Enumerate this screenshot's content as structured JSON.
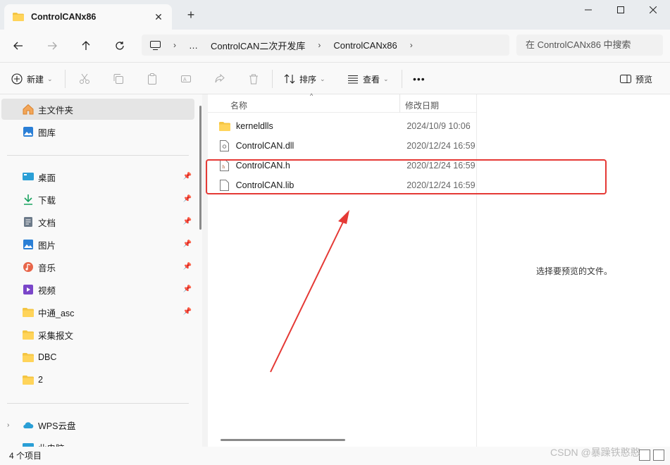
{
  "window": {
    "tab_title": "ControlCANx86",
    "tab_close": "✕",
    "new_tab": "+"
  },
  "address": {
    "segments": [
      "…",
      "ControlCAN二次开发库",
      "ControlCANx86"
    ],
    "search_placeholder": "在 ControlCANx86 中搜索"
  },
  "toolbar": {
    "new_label": "新建",
    "sort_label": "排序",
    "view_label": "查看",
    "more_label": "•••",
    "preview_label": "预览"
  },
  "sidebar": {
    "top": [
      {
        "label": "主文件夹",
        "icon": "home-icon",
        "selected": true
      },
      {
        "label": "图库",
        "icon": "gallery-icon"
      }
    ],
    "quick": [
      {
        "label": "桌面",
        "icon": "desktop-icon",
        "color": "#2a9fd6"
      },
      {
        "label": "下载",
        "icon": "download-icon",
        "color": "#1aa260"
      },
      {
        "label": "文档",
        "icon": "document-icon",
        "color": "#6c7a89"
      },
      {
        "label": "图片",
        "icon": "picture-icon",
        "color": "#2a7fd6"
      },
      {
        "label": "音乐",
        "icon": "music-icon",
        "color": "#e8664a"
      },
      {
        "label": "视频",
        "icon": "video-icon",
        "color": "#7a46c9"
      },
      {
        "label": "中通_asc",
        "icon": "folder-icon",
        "color": "#f4c542"
      },
      {
        "label": "采集报文",
        "icon": "folder-icon",
        "color": "#f4c542"
      },
      {
        "label": "DBC",
        "icon": "folder-icon",
        "color": "#f4c542"
      },
      {
        "label": "2",
        "icon": "folder-icon",
        "color": "#f4c542"
      }
    ],
    "cloud": [
      {
        "label": "WPS云盘",
        "icon": "cloud-icon"
      },
      {
        "label": "此电脑",
        "icon": "computer-icon"
      }
    ]
  },
  "columns": {
    "name": "名称",
    "date": "修改日期"
  },
  "files": [
    {
      "name": "kerneldlls",
      "date": "2024/10/9 10:06",
      "icon": "folder-icon"
    },
    {
      "name": "ControlCAN.dll",
      "date": "2020/12/24 16:59",
      "icon": "dll-file-icon"
    },
    {
      "name": "ControlCAN.h",
      "date": "2020/12/24 16:59",
      "icon": "header-file-icon"
    },
    {
      "name": "ControlCAN.lib",
      "date": "2020/12/24 16:59",
      "icon": "lib-file-icon"
    }
  ],
  "preview": {
    "message": "选择要预览的文件。"
  },
  "status": {
    "count_text": "4 个项目"
  },
  "watermark": "CSDN @暴躁铁憨憨",
  "colors": {
    "annotation_red": "#e53935",
    "folder_yellow": "#f4c542"
  }
}
